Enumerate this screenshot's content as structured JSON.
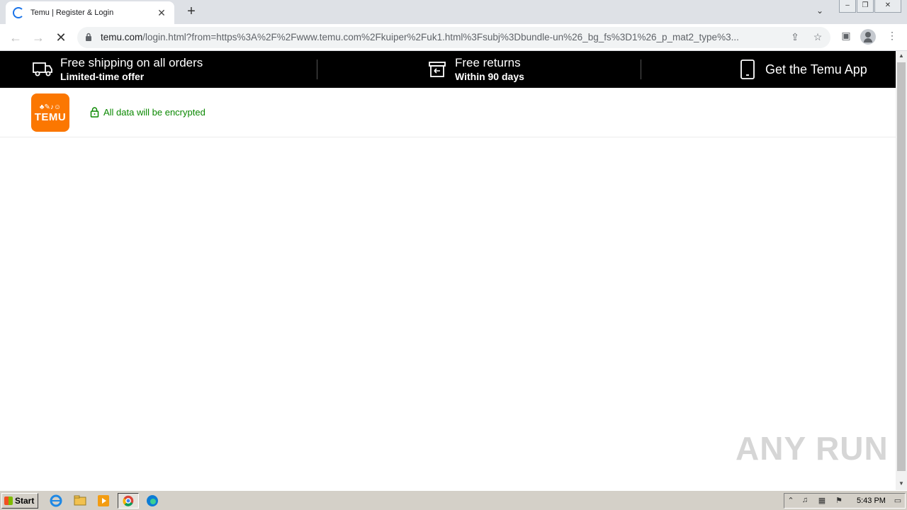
{
  "browser": {
    "tab_title": "Temu | Register & Login",
    "tab_close": "✕",
    "new_tab": "+",
    "url_host": "temu.com",
    "url_rest": "/login.html?from=https%3A%2F%2Fwww.temu.com%2Fkuiper%2Fuk1.html%3Fsubj%3Dbundle-un%26_bg_fs%3D1%26_p_mat2_type%3...",
    "nav_back": "←",
    "nav_forward": "→",
    "nav_stop": "✕"
  },
  "promo": {
    "shipping_title": "Free shipping on all orders",
    "shipping_sub": "Limited-time offer",
    "returns_title": "Free returns",
    "returns_sub": "Within 90 days",
    "app_label": "Get the Temu App"
  },
  "header": {
    "logo_word": "TEMU",
    "logo_glyphs": "♣✎♪☺",
    "encrypt_text": "All data will be encrypted"
  },
  "watermark": "ANY RUN",
  "taskbar": {
    "start_label": "Start",
    "clock": "5:43 PM"
  },
  "colors": {
    "promo_bg": "#000000",
    "brand": "#fb7701",
    "secure_green": "#0a8800"
  }
}
